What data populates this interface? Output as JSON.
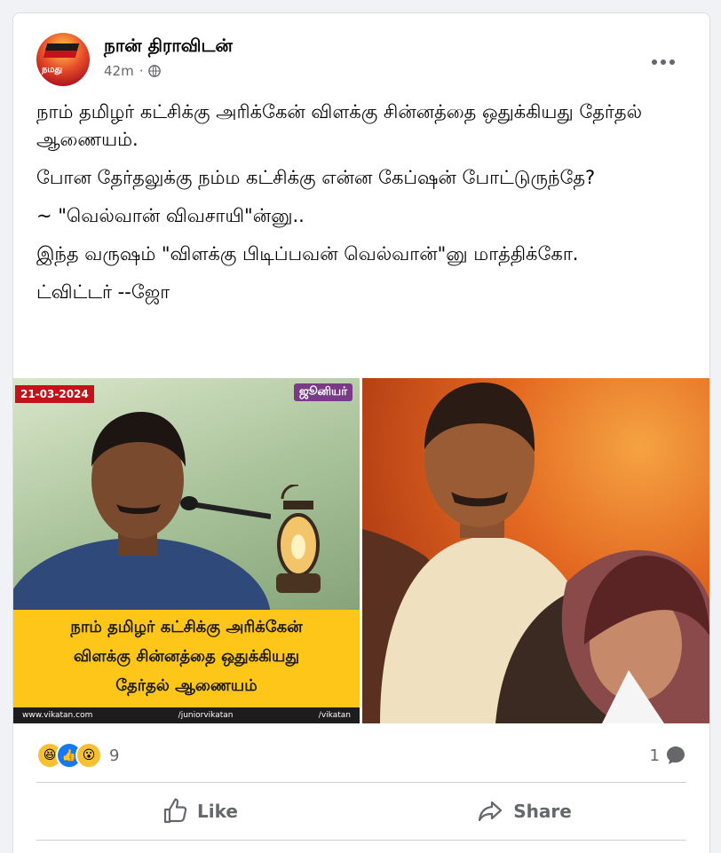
{
  "post": {
    "page_name": "நான் திராவிடன்",
    "time": "42m",
    "avatar_text": "நமது",
    "body": [
      "நாம் தமிழர் கட்சிக்கு அரிக்கேன் விளக்கு சின்னத்தை ஒதுக்கியது தேர்தல் ஆணையம்.",
      "போன தேர்தலுக்கு  நம்ம கட்சிக்கு என்ன கேப்ஷன் போட்டுருந்தே?",
      "~ \"வெல்வான் விவசாயி\"ன்னு..",
      "இந்த வருஷம் \"விளக்கு பிடிப்பவன் வெல்வான்\"னு மாத்திக்கோ.",
      "ட்விட்டர் --ஜோ"
    ]
  },
  "image_left": {
    "date": "21-03-2024",
    "brand": "ஜூனியர்",
    "caption_lines": [
      "நாம் தமிழர் கட்சிக்கு அரிக்கேன்",
      "விளக்கு சின்னத்தை ஒதுக்கியது",
      "தேர்தல் ஆணையம்"
    ],
    "footer_left": "www.vikatan.com",
    "footer_mid": "/juniorvikatan",
    "footer_right": "/vikatan"
  },
  "stats": {
    "reaction_count": "9",
    "comment_count": "1"
  },
  "actions": {
    "like": "Like",
    "share": "Share"
  },
  "colors": {
    "accent": "#1877f2",
    "muted": "#65676b",
    "caption_bg": "#ffc61a"
  }
}
